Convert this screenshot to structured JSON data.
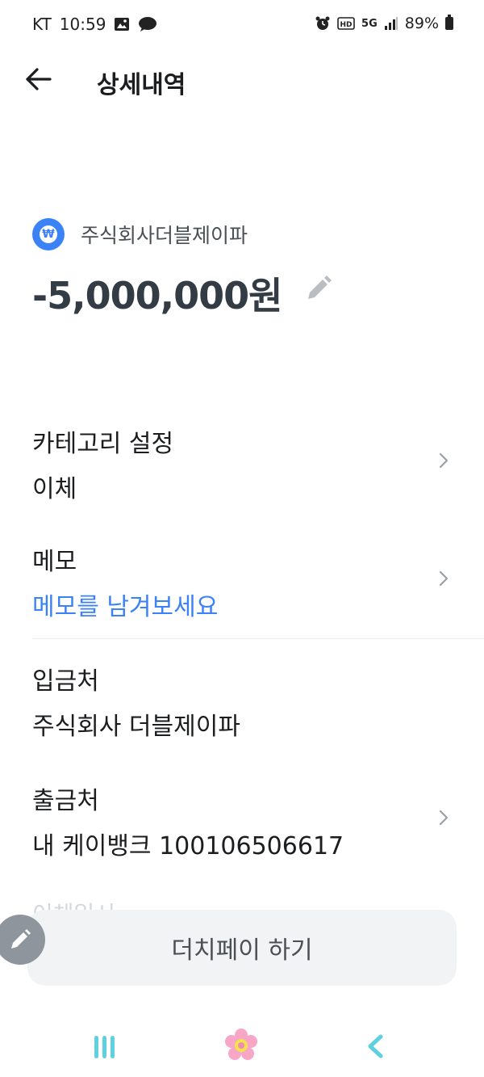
{
  "status_bar": {
    "carrier": "KT",
    "time": "10:59",
    "network": "5G",
    "battery": "89%",
    "icons_left": [
      "image-icon",
      "chat-bubble-icon"
    ],
    "icons_right": [
      "alarm-icon",
      "hd-icon",
      "5g-icon",
      "signal-icon",
      "battery-icon"
    ]
  },
  "header": {
    "title": "상세내역"
  },
  "transaction": {
    "merchant": "주식회사더블제이파",
    "amount": "-5,000,000원"
  },
  "details": {
    "category": {
      "label": "카테고리 설정",
      "value": "이체"
    },
    "memo": {
      "label": "메모",
      "placeholder": "메모를 남겨보세요"
    },
    "depositor": {
      "label": "입금처",
      "value": "주식회사 더블제이파"
    },
    "withdrawal": {
      "label": "출금처",
      "value": "내 케이뱅크 100106506617"
    },
    "partial_next_label": "이체일시"
  },
  "actions": {
    "dutch_pay": "더치페이 하기"
  },
  "colors": {
    "accent": "#3b82f6",
    "text_primary": "#1b1d1f",
    "text_secondary": "#4a4f55",
    "button_bg": "#f1f3f5"
  }
}
